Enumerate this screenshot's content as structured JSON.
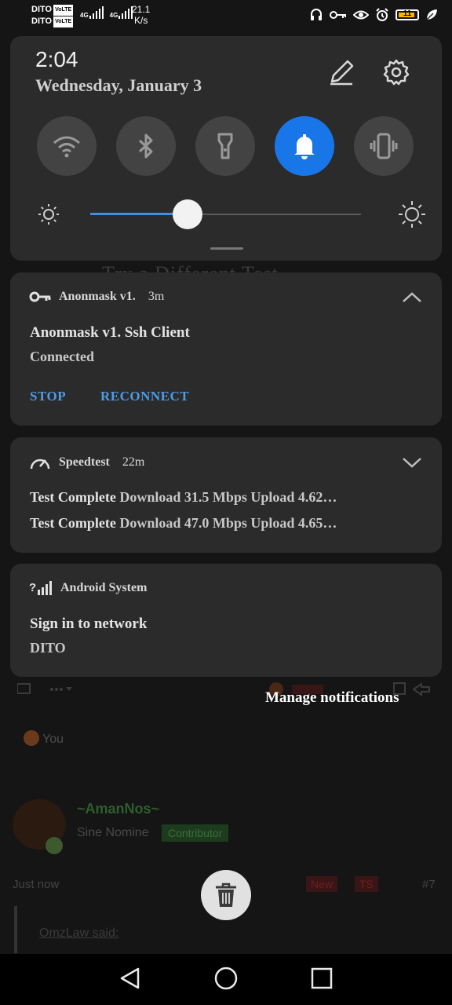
{
  "status_bar": {
    "carrier1": "DITO",
    "carrier2": "DITO",
    "volte": "VoLTE",
    "net1": "4G",
    "net2": "4G",
    "speed_value": "21.1",
    "speed_unit": "K/s",
    "battery_level": "11",
    "icons": [
      "headset-icon",
      "vpn-key-icon",
      "eye-icon",
      "alarm-icon",
      "battery-icon",
      "leaf-icon"
    ]
  },
  "quick_settings": {
    "time": "2:04",
    "date": "Wednesday, January 3",
    "brightness_level": 0.36,
    "tiles": [
      {
        "name": "wifi",
        "icon": "wifi-icon",
        "active": false
      },
      {
        "name": "bluetooth",
        "icon": "bluetooth-icon",
        "active": false
      },
      {
        "name": "flashlight",
        "icon": "flashlight-icon",
        "active": false
      },
      {
        "name": "sound",
        "icon": "bell-icon",
        "active": true
      },
      {
        "name": "vibrate",
        "icon": "vibrate-icon",
        "active": false
      }
    ]
  },
  "notifications": [
    {
      "app": "Anonmask v1.",
      "time": "3m",
      "title": "Anonmask v1. Ssh Client",
      "text": "Connected",
      "actions": [
        "STOP",
        "RECONNECT"
      ]
    },
    {
      "app": "Speedtest",
      "time": "22m",
      "lines": [
        {
          "bold": "Test Complete",
          "text": "Download 31.5 Mbps  Upload 4.62…"
        },
        {
          "bold": "Test Complete",
          "text": "Download 47.0 Mbps  Upload 4.65…"
        }
      ]
    },
    {
      "app": "Android System",
      "title": "Sign in to network",
      "text": "DITO"
    }
  ],
  "manage_label": "Manage notifications",
  "background_app": {
    "title": "Try a Different Test",
    "reaction": "You",
    "username": "~AmanNos~",
    "subtitle": "Sine Nomine",
    "badge": "Contributor",
    "time": "Just now",
    "tag_new": "New",
    "tag_ts": "TS",
    "post_number": "#7",
    "quote_author": "OmzLaw said:"
  }
}
